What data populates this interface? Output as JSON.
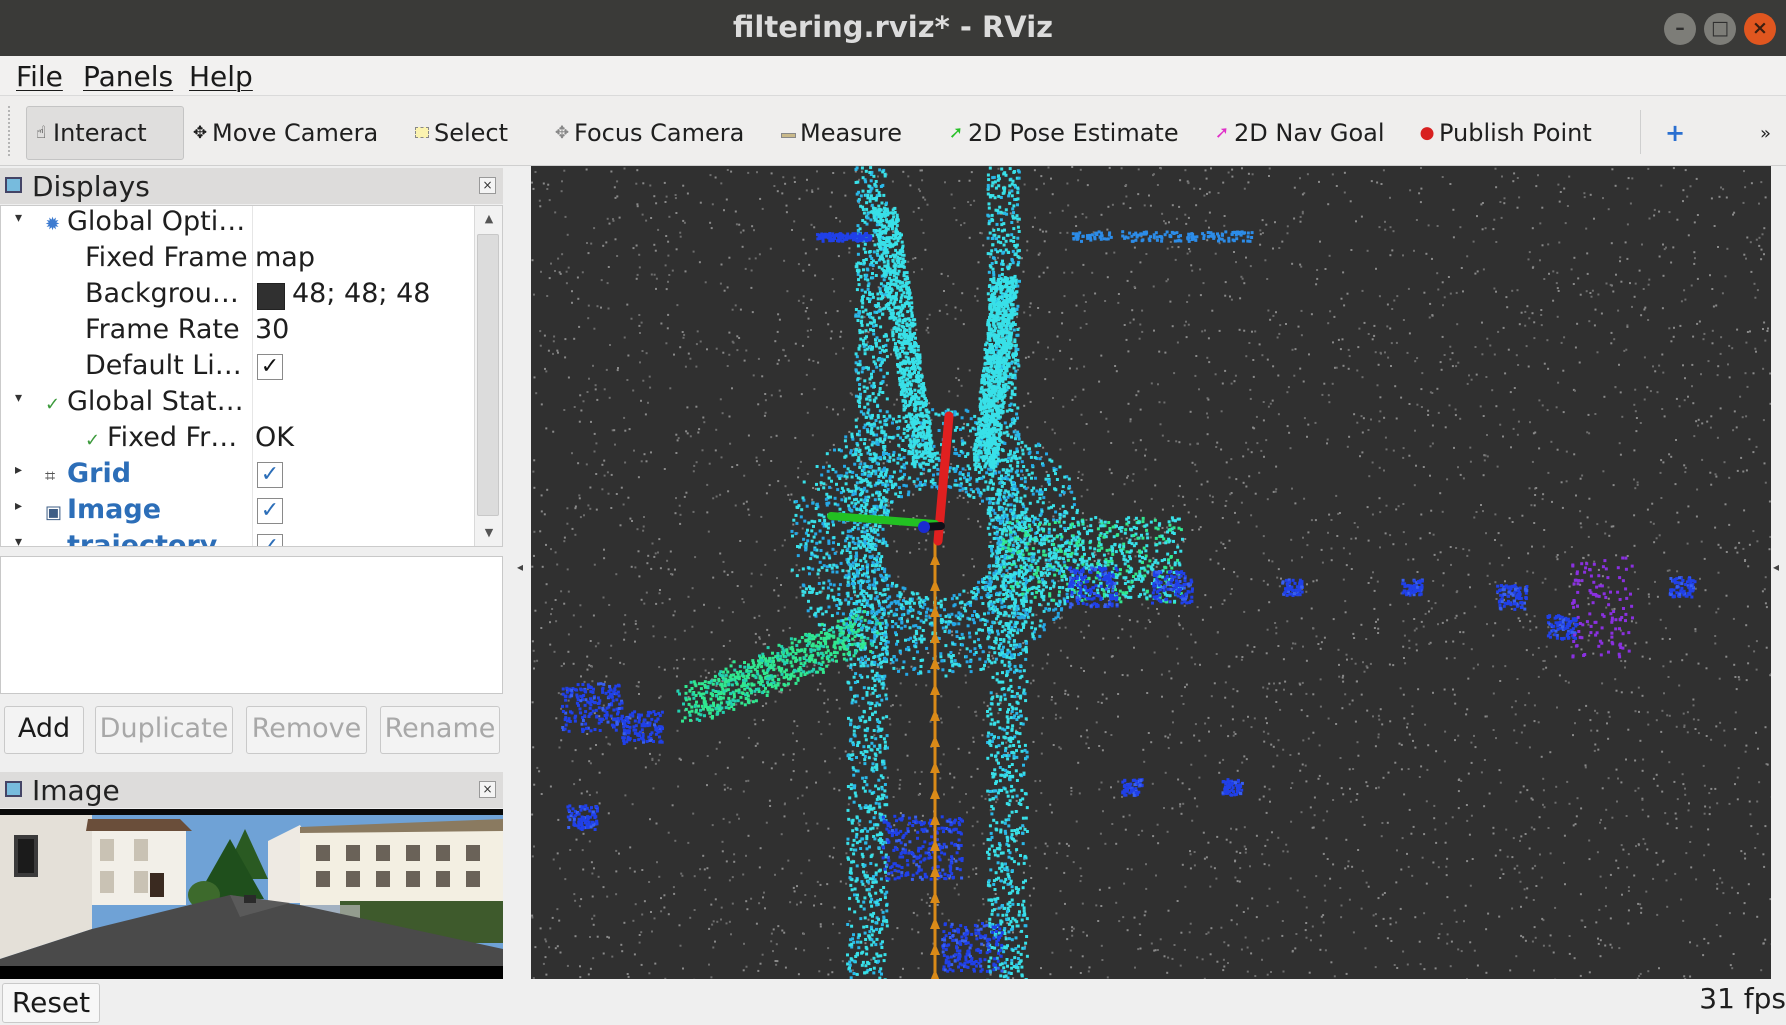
{
  "window": {
    "title": "filtering.rviz* - RViz",
    "minimize": "–",
    "maximize": "□",
    "close": "×"
  },
  "menu": {
    "file": "File",
    "panels": "Panels",
    "help": "Help"
  },
  "toolbar": {
    "interact": "Interact",
    "move_camera": "Move Camera",
    "select": "Select",
    "focus_camera": "Focus Camera",
    "measure": "Measure",
    "pose_estimate": "2D Pose Estimate",
    "nav_goal": "2D Nav Goal",
    "publish_point": "Publish Point",
    "add_tool": "+",
    "more": "»"
  },
  "displays": {
    "title": "Displays",
    "close": "×",
    "rows": [
      {
        "name": "Global Opti…",
        "value": ""
      },
      {
        "name": "Fixed Frame",
        "value": "map"
      },
      {
        "name": "Backgrou…",
        "value": "48; 48; 48"
      },
      {
        "name": "Frame Rate",
        "value": "30"
      },
      {
        "name": "Default Li…",
        "value": ""
      },
      {
        "name": "Global Stat…",
        "value": ""
      },
      {
        "name": "Fixed Fr…",
        "value": "OK"
      },
      {
        "name": "Grid",
        "value": ""
      },
      {
        "name": "Image",
        "value": ""
      },
      {
        "name": "trajectory",
        "value": ""
      }
    ],
    "checkmark": "✓",
    "background_color": "#303030"
  },
  "buttons": {
    "add": "Add",
    "duplicate": "Duplicate",
    "remove": "Remove",
    "rename": "Rename"
  },
  "image_panel": {
    "title": "Image",
    "close": "×"
  },
  "status": {
    "reset": "Reset",
    "fps": "31 fps"
  },
  "colors": {
    "accent_blue": "#2c6eb8",
    "ok_green": "#3c9a3c",
    "axis_x": "#e02020",
    "axis_y": "#22c022",
    "axis_z": "#1a2bd0",
    "trajectory": "#d98a18",
    "cloud_cyan": "#38e0e8",
    "cloud_blue": "#2040e8",
    "cloud_green": "#30e890",
    "cloud_violet": "#8a30e0",
    "cloud_grey": "#8a8a8a"
  }
}
